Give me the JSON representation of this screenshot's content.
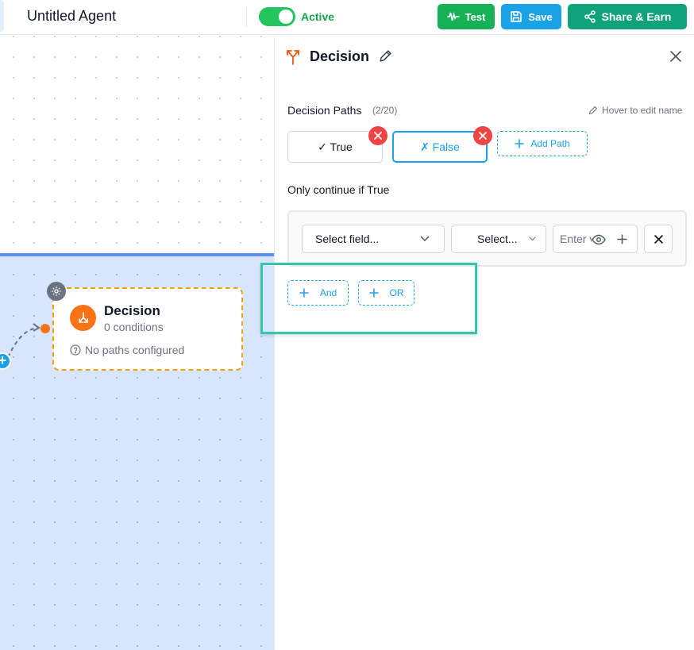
{
  "header": {
    "agent_title": "Untitled Agent",
    "status_label": "Active",
    "status_active": true,
    "test_label": "Test",
    "save_label": "Save",
    "share_label": "Share & Earn",
    "colors": {
      "test": "#16b057",
      "save": "#1ba1e6",
      "share": "#10a37a",
      "toggle": "#22c55e"
    },
    "icons": [
      "waveform-icon",
      "save-icon",
      "share-icon"
    ]
  },
  "canvas": {
    "node": {
      "title": "Decision",
      "conditions": "0 conditions",
      "paths_status": "No paths configured",
      "accent": "#f97316",
      "icons": [
        "gear-icon",
        "decision-split-icon",
        "help-circle-icon"
      ]
    },
    "add_icon": "plus-icon"
  },
  "panel": {
    "title": "Decision",
    "icons": [
      "branch-icon",
      "pencil-icon",
      "close-icon"
    ],
    "decision_paths_label": "Decision Paths",
    "decision_paths_count": "(2/20)",
    "hover_hint": "Hover to edit name",
    "paths": [
      {
        "label": "✓ True",
        "selected": false
      },
      {
        "label": "✗ False",
        "selected": true
      }
    ],
    "add_path_label": "Add Path",
    "condition_heading": "Only continue if True",
    "condition": {
      "field_placeholder": "Select field...",
      "operator_placeholder": "Select...",
      "value_placeholder": "Enter value"
    },
    "and_label": "And",
    "or_label": "OR",
    "highlight_color": "#33c7a5"
  }
}
